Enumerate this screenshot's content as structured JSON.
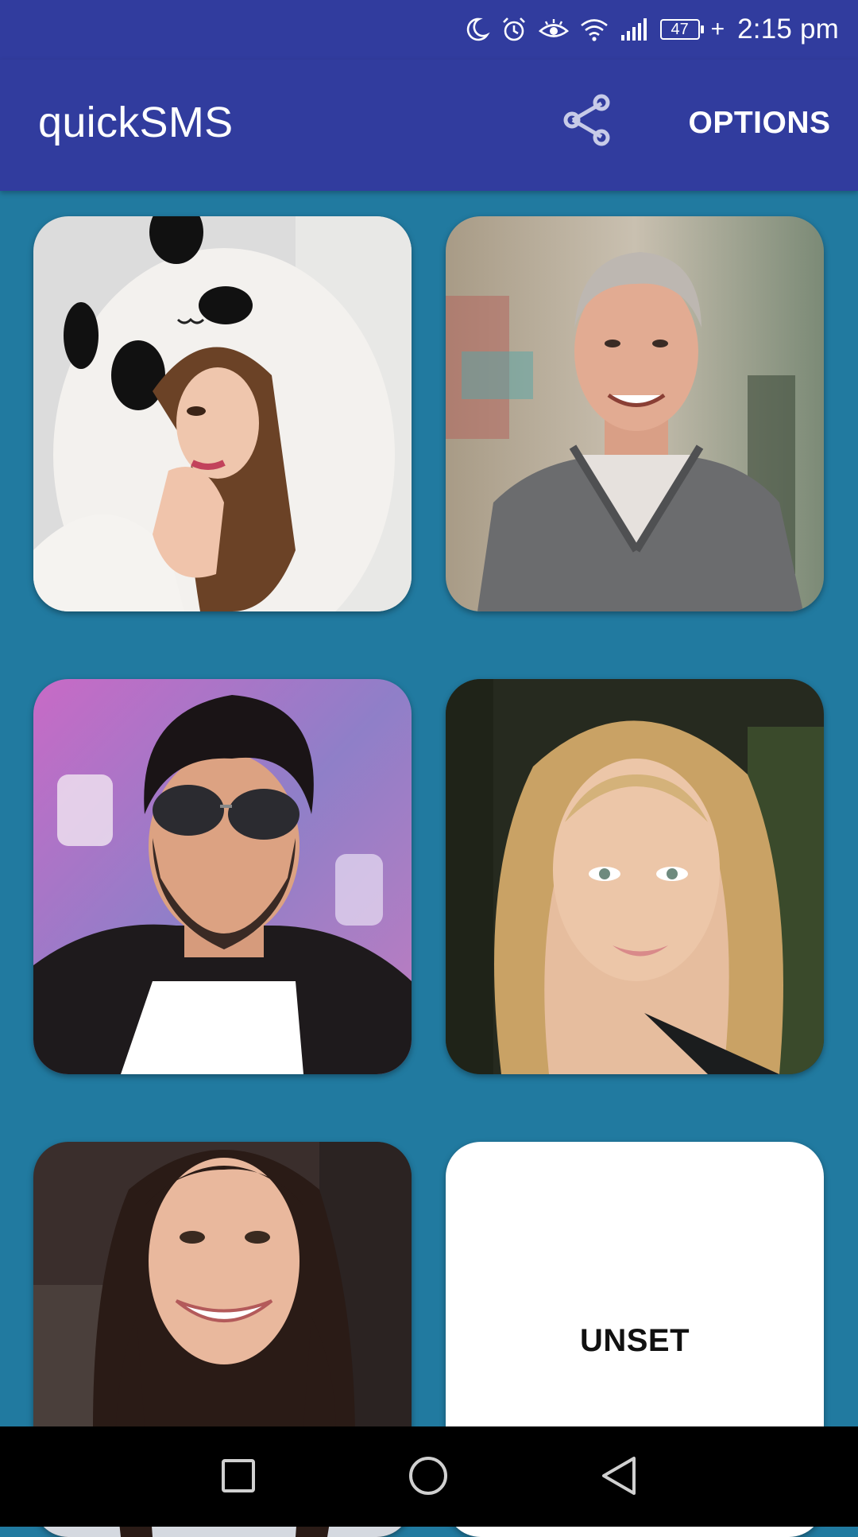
{
  "status_bar": {
    "time": "2:15 pm",
    "battery_level": "47",
    "battery_charging_symbol": "+",
    "icons": [
      "moon-icon",
      "alarm-icon",
      "eye-comfort-icon",
      "wifi-icon",
      "cellular-signal-icon",
      "battery-icon"
    ]
  },
  "app_bar": {
    "title": "quickSMS",
    "share_icon": "share-icon",
    "options_label": "OPTIONS"
  },
  "contacts": [
    {
      "slot": 1,
      "icon": "contact-photo-woman-panda-hood"
    },
    {
      "slot": 2,
      "icon": "contact-photo-older-man-sweater"
    },
    {
      "slot": 3,
      "icon": "contact-photo-man-sunglasses"
    },
    {
      "slot": 4,
      "icon": "contact-photo-blonde-woman"
    },
    {
      "slot": 5,
      "icon": "contact-photo-smiling-woman"
    },
    {
      "slot": 6,
      "label": "UNSET"
    }
  ],
  "nav_bar": {
    "icons": [
      "recents-square-icon",
      "home-circle-icon",
      "back-triangle-icon"
    ]
  },
  "colors": {
    "app_bar": "#313c9e",
    "background": "#217aa0",
    "nav_bar": "#000000",
    "card_unset": "#ffffff"
  }
}
